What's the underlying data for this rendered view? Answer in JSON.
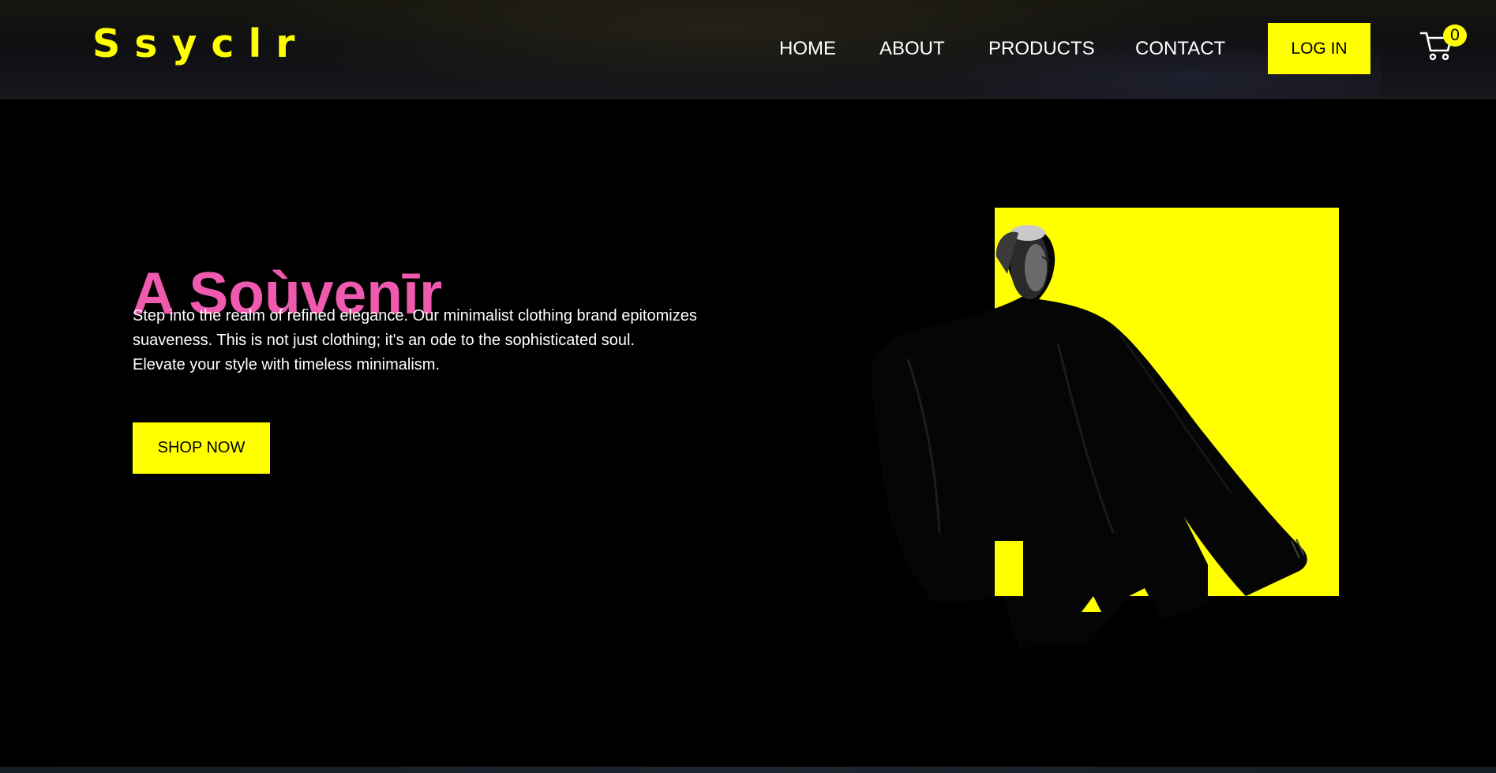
{
  "brand": {
    "logo_text": "Ssyclr",
    "accent_color": "#ffff00",
    "title_color": "#ef5aaf"
  },
  "nav": {
    "links": [
      {
        "label": "HOME"
      },
      {
        "label": "ABOUT"
      },
      {
        "label": "PRODUCTS"
      },
      {
        "label": "CONTACT"
      }
    ],
    "login_label": "LOG IN",
    "cart_icon": "cart-icon",
    "cart_count": "0"
  },
  "hero": {
    "title": "A Soùvenīr",
    "description": "Step into the realm of refined elegance. Our minimalist clothing brand epitomizes suaveness. This is not just clothing; it's an ode to the sophisticated soul.",
    "tagline": "Elevate your style with timeless minimalism.",
    "cta_label": "SHOP NOW",
    "image": "model-in-black-coat-on-yellow-square"
  }
}
